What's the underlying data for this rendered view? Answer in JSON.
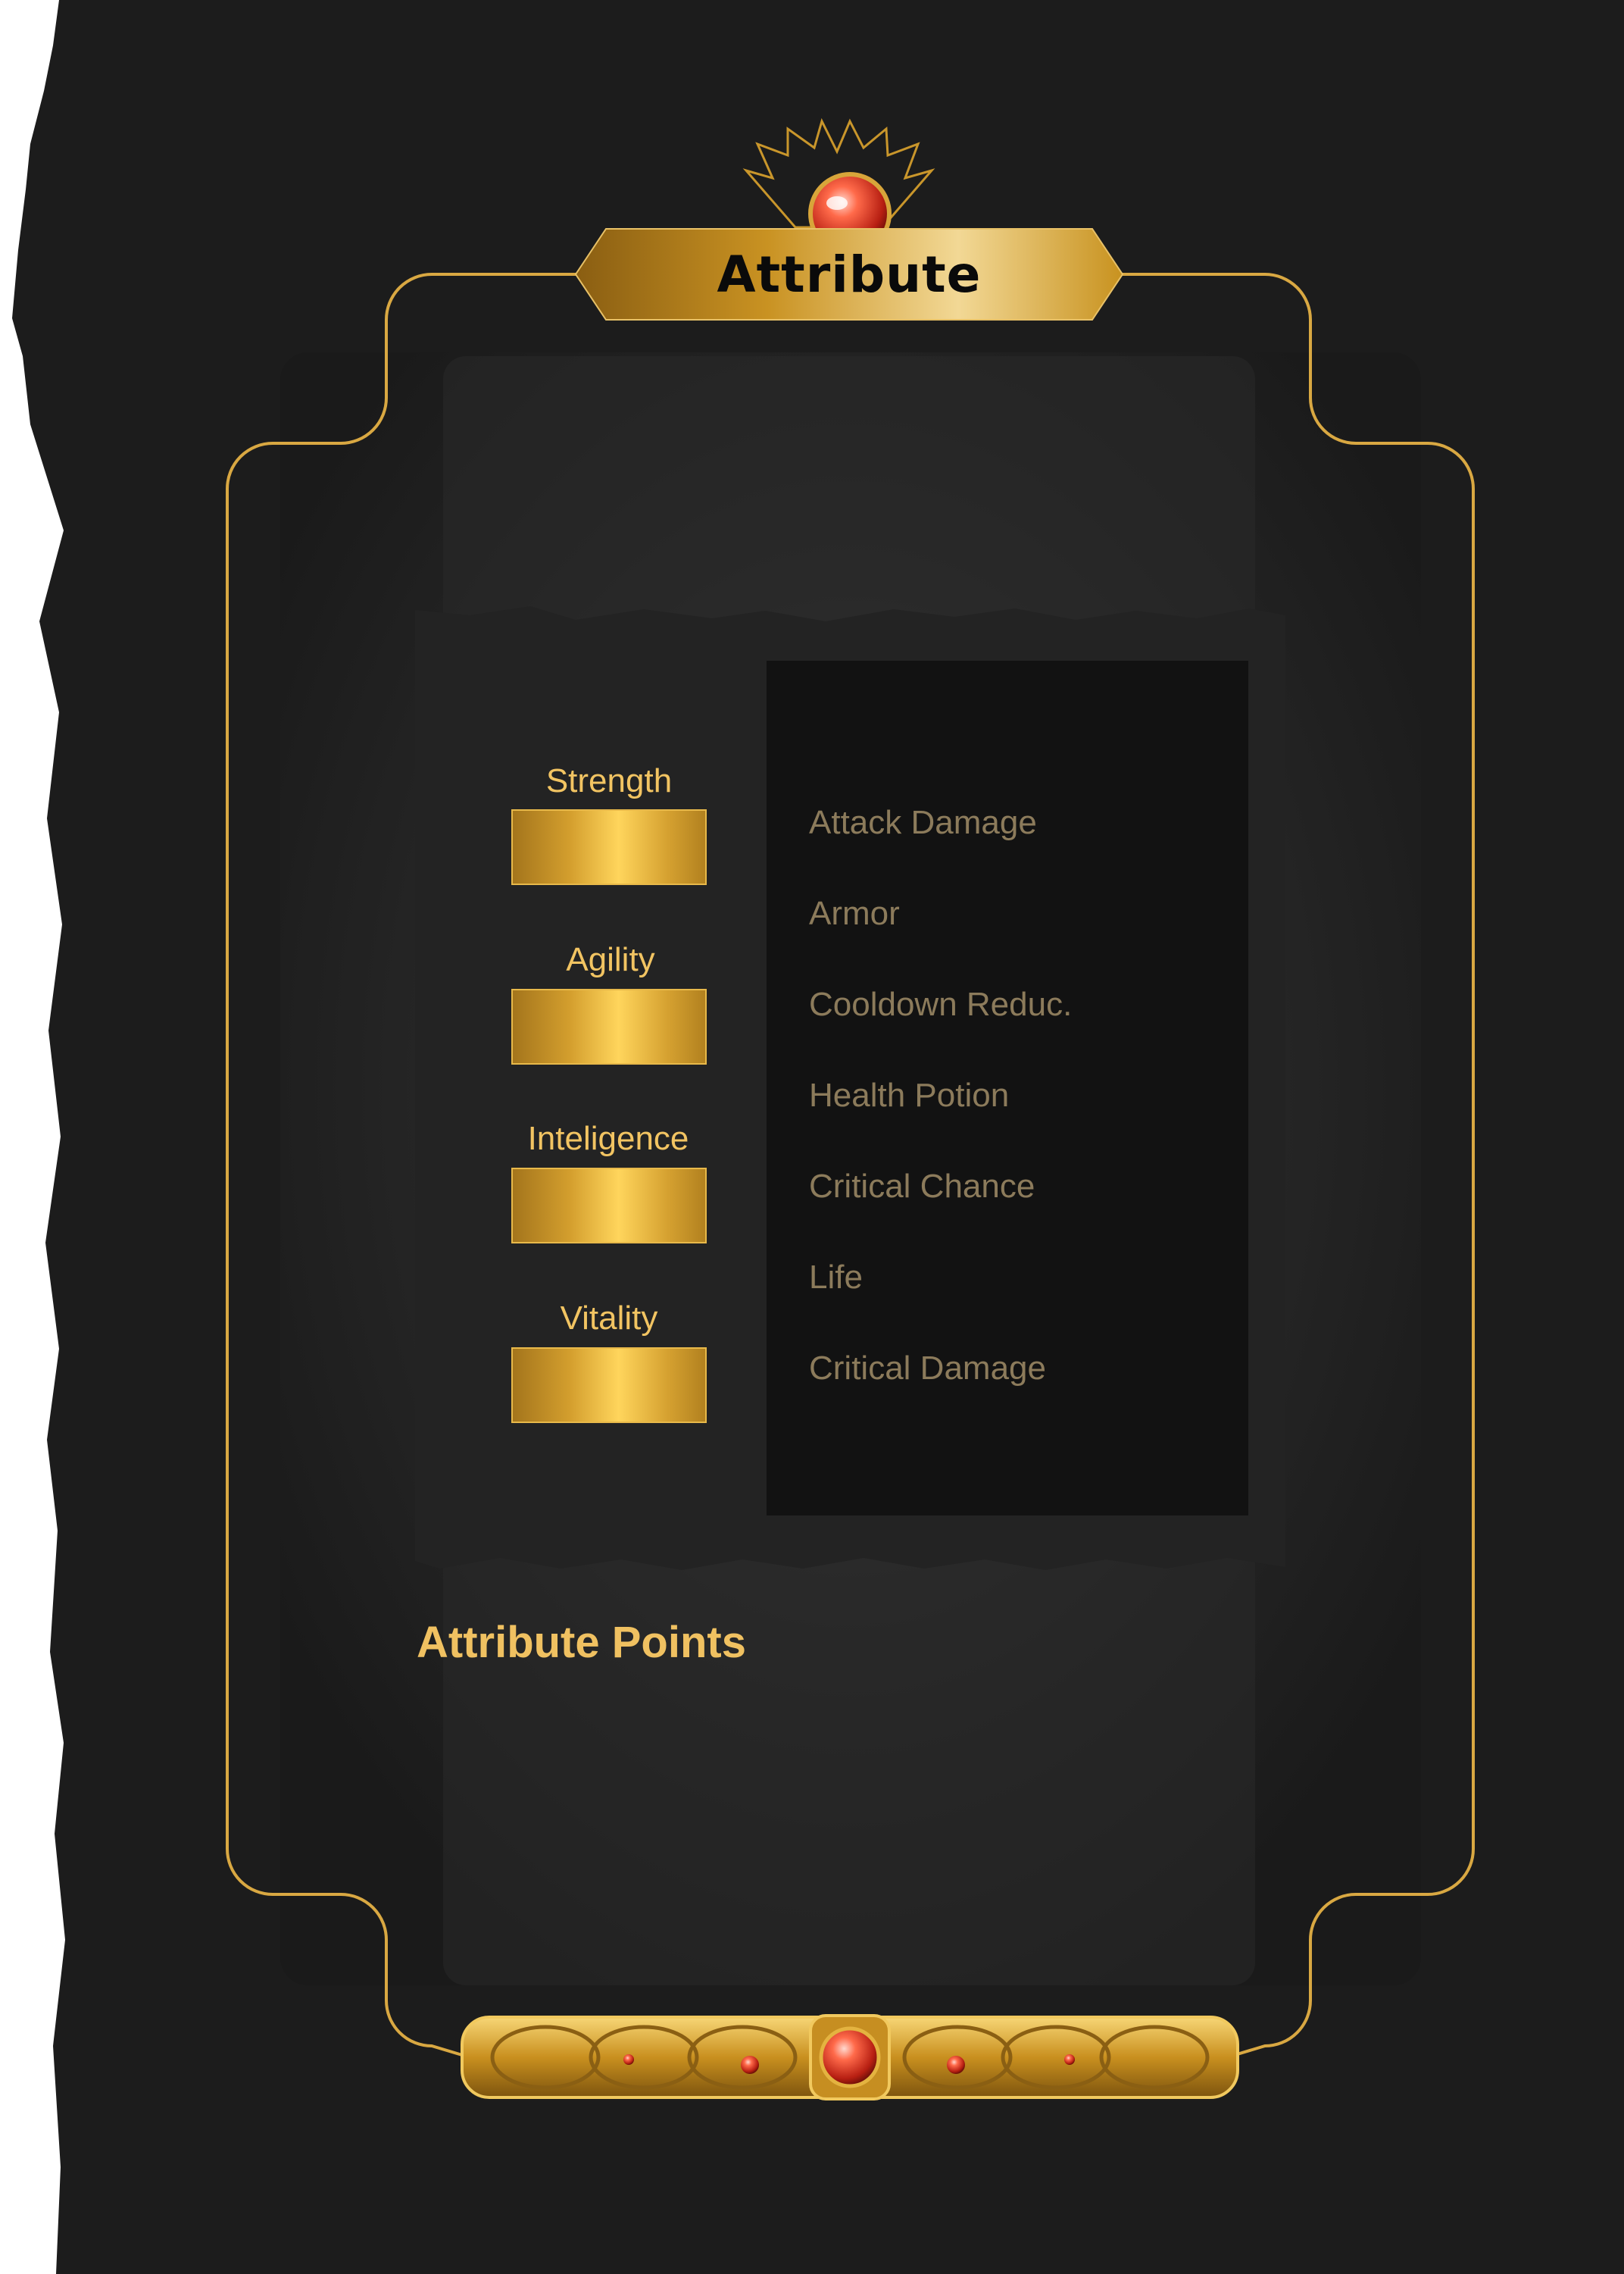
{
  "window": {
    "title": "Attribute"
  },
  "attributes": [
    {
      "label": "Strength"
    },
    {
      "label": "Agility"
    },
    {
      "label": "Inteligence"
    },
    {
      "label": "Vitality"
    }
  ],
  "stats": [
    "Attack Damage",
    "Armor",
    "Cooldown Reduc.",
    "Health Potion",
    "Critical Chance",
    "Life",
    "Critical Damage"
  ],
  "footer": {
    "points_label": "Attribute Points"
  },
  "colors": {
    "gold": "#f2c462",
    "stat_text": "#8c7b5b",
    "panel": "#222222",
    "background": "#1a1a1a",
    "gem": "#e8432c"
  },
  "icons": {
    "top_ornament": "sunburst-gem-icon",
    "bottom_ornament": "gold-filigree-bar-icon"
  }
}
